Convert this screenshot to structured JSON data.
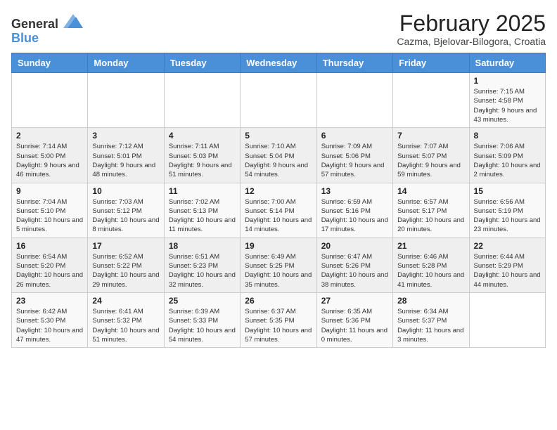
{
  "logo": {
    "general": "General",
    "blue": "Blue"
  },
  "title": "February 2025",
  "subtitle": "Cazma, Bjelovar-Bilogora, Croatia",
  "weekdays": [
    "Sunday",
    "Monday",
    "Tuesday",
    "Wednesday",
    "Thursday",
    "Friday",
    "Saturday"
  ],
  "weeks": [
    [
      {
        "day": "",
        "info": ""
      },
      {
        "day": "",
        "info": ""
      },
      {
        "day": "",
        "info": ""
      },
      {
        "day": "",
        "info": ""
      },
      {
        "day": "",
        "info": ""
      },
      {
        "day": "",
        "info": ""
      },
      {
        "day": "1",
        "info": "Sunrise: 7:15 AM\nSunset: 4:58 PM\nDaylight: 9 hours and 43 minutes."
      }
    ],
    [
      {
        "day": "2",
        "info": "Sunrise: 7:14 AM\nSunset: 5:00 PM\nDaylight: 9 hours and 46 minutes."
      },
      {
        "day": "3",
        "info": "Sunrise: 7:12 AM\nSunset: 5:01 PM\nDaylight: 9 hours and 48 minutes."
      },
      {
        "day": "4",
        "info": "Sunrise: 7:11 AM\nSunset: 5:03 PM\nDaylight: 9 hours and 51 minutes."
      },
      {
        "day": "5",
        "info": "Sunrise: 7:10 AM\nSunset: 5:04 PM\nDaylight: 9 hours and 54 minutes."
      },
      {
        "day": "6",
        "info": "Sunrise: 7:09 AM\nSunset: 5:06 PM\nDaylight: 9 hours and 57 minutes."
      },
      {
        "day": "7",
        "info": "Sunrise: 7:07 AM\nSunset: 5:07 PM\nDaylight: 9 hours and 59 minutes."
      },
      {
        "day": "8",
        "info": "Sunrise: 7:06 AM\nSunset: 5:09 PM\nDaylight: 10 hours and 2 minutes."
      }
    ],
    [
      {
        "day": "9",
        "info": "Sunrise: 7:04 AM\nSunset: 5:10 PM\nDaylight: 10 hours and 5 minutes."
      },
      {
        "day": "10",
        "info": "Sunrise: 7:03 AM\nSunset: 5:12 PM\nDaylight: 10 hours and 8 minutes."
      },
      {
        "day": "11",
        "info": "Sunrise: 7:02 AM\nSunset: 5:13 PM\nDaylight: 10 hours and 11 minutes."
      },
      {
        "day": "12",
        "info": "Sunrise: 7:00 AM\nSunset: 5:14 PM\nDaylight: 10 hours and 14 minutes."
      },
      {
        "day": "13",
        "info": "Sunrise: 6:59 AM\nSunset: 5:16 PM\nDaylight: 10 hours and 17 minutes."
      },
      {
        "day": "14",
        "info": "Sunrise: 6:57 AM\nSunset: 5:17 PM\nDaylight: 10 hours and 20 minutes."
      },
      {
        "day": "15",
        "info": "Sunrise: 6:56 AM\nSunset: 5:19 PM\nDaylight: 10 hours and 23 minutes."
      }
    ],
    [
      {
        "day": "16",
        "info": "Sunrise: 6:54 AM\nSunset: 5:20 PM\nDaylight: 10 hours and 26 minutes."
      },
      {
        "day": "17",
        "info": "Sunrise: 6:52 AM\nSunset: 5:22 PM\nDaylight: 10 hours and 29 minutes."
      },
      {
        "day": "18",
        "info": "Sunrise: 6:51 AM\nSunset: 5:23 PM\nDaylight: 10 hours and 32 minutes."
      },
      {
        "day": "19",
        "info": "Sunrise: 6:49 AM\nSunset: 5:25 PM\nDaylight: 10 hours and 35 minutes."
      },
      {
        "day": "20",
        "info": "Sunrise: 6:47 AM\nSunset: 5:26 PM\nDaylight: 10 hours and 38 minutes."
      },
      {
        "day": "21",
        "info": "Sunrise: 6:46 AM\nSunset: 5:28 PM\nDaylight: 10 hours and 41 minutes."
      },
      {
        "day": "22",
        "info": "Sunrise: 6:44 AM\nSunset: 5:29 PM\nDaylight: 10 hours and 44 minutes."
      }
    ],
    [
      {
        "day": "23",
        "info": "Sunrise: 6:42 AM\nSunset: 5:30 PM\nDaylight: 10 hours and 47 minutes."
      },
      {
        "day": "24",
        "info": "Sunrise: 6:41 AM\nSunset: 5:32 PM\nDaylight: 10 hours and 51 minutes."
      },
      {
        "day": "25",
        "info": "Sunrise: 6:39 AM\nSunset: 5:33 PM\nDaylight: 10 hours and 54 minutes."
      },
      {
        "day": "26",
        "info": "Sunrise: 6:37 AM\nSunset: 5:35 PM\nDaylight: 10 hours and 57 minutes."
      },
      {
        "day": "27",
        "info": "Sunrise: 6:35 AM\nSunset: 5:36 PM\nDaylight: 11 hours and 0 minutes."
      },
      {
        "day": "28",
        "info": "Sunrise: 6:34 AM\nSunset: 5:37 PM\nDaylight: 11 hours and 3 minutes."
      },
      {
        "day": "",
        "info": ""
      }
    ]
  ]
}
